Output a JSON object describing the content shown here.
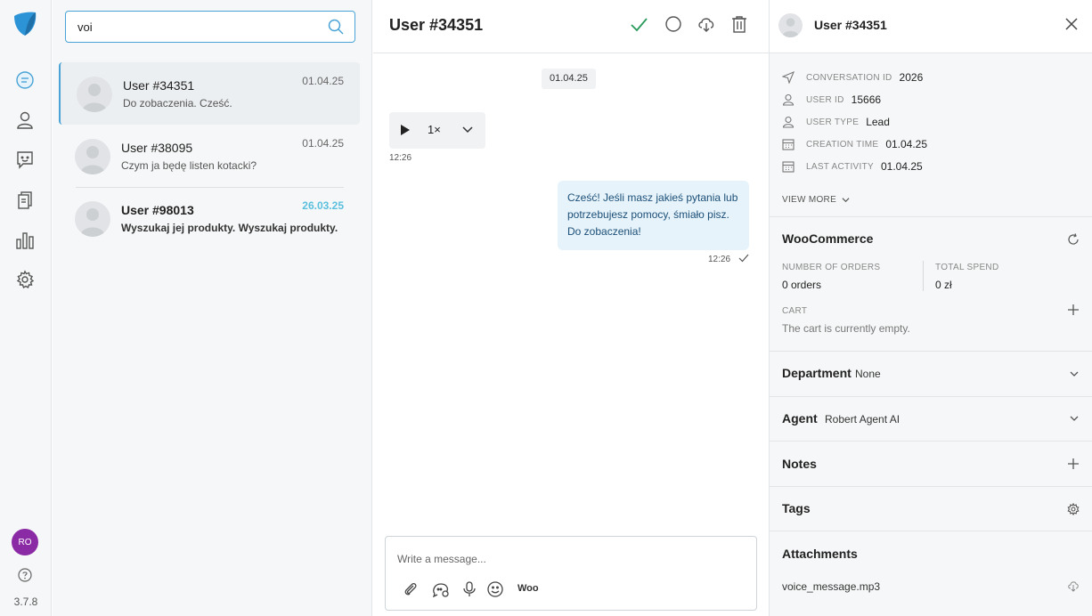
{
  "rail": {
    "brand_color": "#2b93d6",
    "nav": [
      "chat-icon",
      "users-icon",
      "chatbot-icon",
      "articles-icon",
      "reports-icon",
      "settings-icon"
    ],
    "avatar_initials": "RO",
    "version": "3.7.8"
  },
  "list": {
    "search_value": "voi",
    "conversations": [
      {
        "name": "User #34351",
        "message": "Do zobaczenia. Cześć.",
        "date": "01.04.25",
        "active": true,
        "unread": false
      },
      {
        "name": "User #38095",
        "message": "Czym ja będę listen kotacki?",
        "date": "01.04.25",
        "active": false,
        "unread": false
      },
      {
        "name": "User #98013",
        "message": "Wyszukaj jej produkty. Wyszukaj produkty.",
        "date": "26.03.25",
        "active": false,
        "unread": true
      }
    ]
  },
  "chat": {
    "title": "User #34351",
    "date_chip": "01.04.25",
    "audio_speed": "1×",
    "incoming_time": "12:26",
    "outgoing_text": "Cześć! Jeśli masz jakieś pytania lub potrzebujesz pomocy, śmiało pisz. Do zobaczenia!",
    "outgoing_time": "12:26",
    "composer_placeholder": "Write a message...",
    "woo_label": "Woo"
  },
  "panel": {
    "title": "User #34351",
    "info": [
      {
        "icon": "send-icon",
        "label": "CONVERSATION ID",
        "value": "2026"
      },
      {
        "icon": "user-icon",
        "label": "USER ID",
        "value": "15666"
      },
      {
        "icon": "user-icon",
        "label": "USER TYPE",
        "value": "Lead"
      },
      {
        "icon": "calendar-icon",
        "label": "CREATION TIME",
        "value": "01.04.25"
      },
      {
        "icon": "calendar-icon",
        "label": "LAST ACTIVITY",
        "value": "01.04.25"
      }
    ],
    "view_more": "VIEW MORE",
    "woocommerce": {
      "title": "WooCommerce",
      "orders_label": "NUMBER OF ORDERS",
      "orders_value": "0 orders",
      "spend_label": "TOTAL SPEND",
      "spend_value": "0 zł",
      "cart_label": "CART",
      "cart_value": "The cart is currently empty."
    },
    "department": {
      "label": "Department",
      "value": "None"
    },
    "agent": {
      "label": "Agent",
      "value": "Robert Agent AI"
    },
    "notes_label": "Notes",
    "tags_label": "Tags",
    "attachments": {
      "label": "Attachments",
      "file": "voice_message.mp3"
    }
  }
}
